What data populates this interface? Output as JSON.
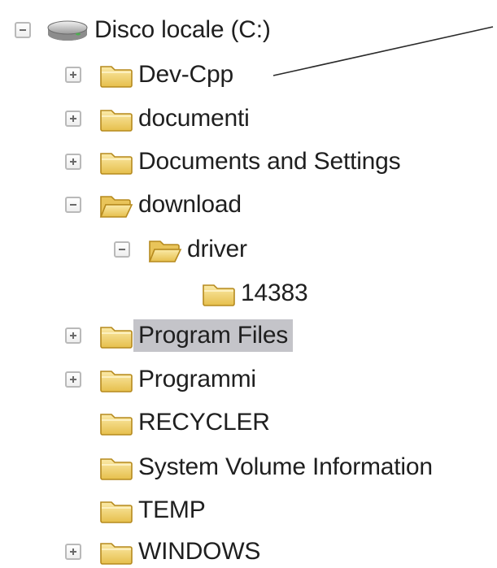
{
  "tree": {
    "root": {
      "label": "Disco locale (C:)",
      "icon": "drive-icon",
      "expander": "collapse"
    },
    "items": [
      {
        "label": "Dev-Cpp",
        "icon": "folder-icon",
        "expander": "expand"
      },
      {
        "label": "documenti",
        "icon": "folder-icon",
        "expander": "expand"
      },
      {
        "label": "Documents and Settings",
        "icon": "folder-icon",
        "expander": "expand"
      },
      {
        "label": "download",
        "icon": "folder-icon",
        "expander": "collapse"
      },
      {
        "label": "driver",
        "icon": "folder-icon",
        "expander": "collapse"
      },
      {
        "label": "14383",
        "icon": "folder-icon",
        "expander": "none"
      },
      {
        "label": "Program Files",
        "icon": "folder-icon",
        "expander": "expand",
        "selected": true
      },
      {
        "label": "Programmi",
        "icon": "folder-icon",
        "expander": "expand"
      },
      {
        "label": "RECYCLER",
        "icon": "folder-icon",
        "expander": "none"
      },
      {
        "label": "System Volume Information",
        "icon": "folder-icon",
        "expander": "none"
      },
      {
        "label": "TEMP",
        "icon": "folder-icon",
        "expander": "none"
      },
      {
        "label": "WINDOWS",
        "icon": "folder-icon",
        "expander": "expand"
      }
    ]
  },
  "colors": {
    "folder_fill": "#f2d67a",
    "folder_edge": "#b68a1e",
    "selection_background": "#c4c4c9",
    "text": "#1f1f1f"
  }
}
